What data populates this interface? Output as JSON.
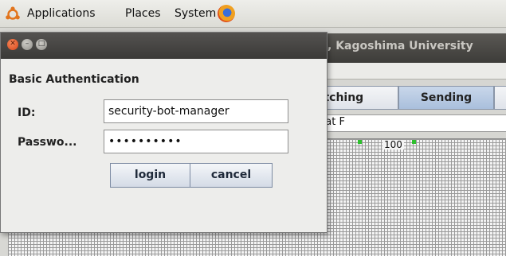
{
  "panel": {
    "menu_applications": "Applications",
    "menu_places": "Places",
    "menu_system": "System"
  },
  "background_window": {
    "title": ", Kagoshima University",
    "tabs": [
      "atching",
      "Sending"
    ],
    "date_text": "Sat F",
    "grid_value": "100"
  },
  "dialog": {
    "heading": "Basic Authentication",
    "id_label": "ID:",
    "id_value": "security-bot-manager",
    "password_label": "Passwo...",
    "password_masked": "••••••••••",
    "login_label": "login",
    "cancel_label": "cancel"
  },
  "colors": {
    "accent_tab": "#a9bfdc",
    "close_button": "#d8451a",
    "marker": "#2ec02e"
  }
}
